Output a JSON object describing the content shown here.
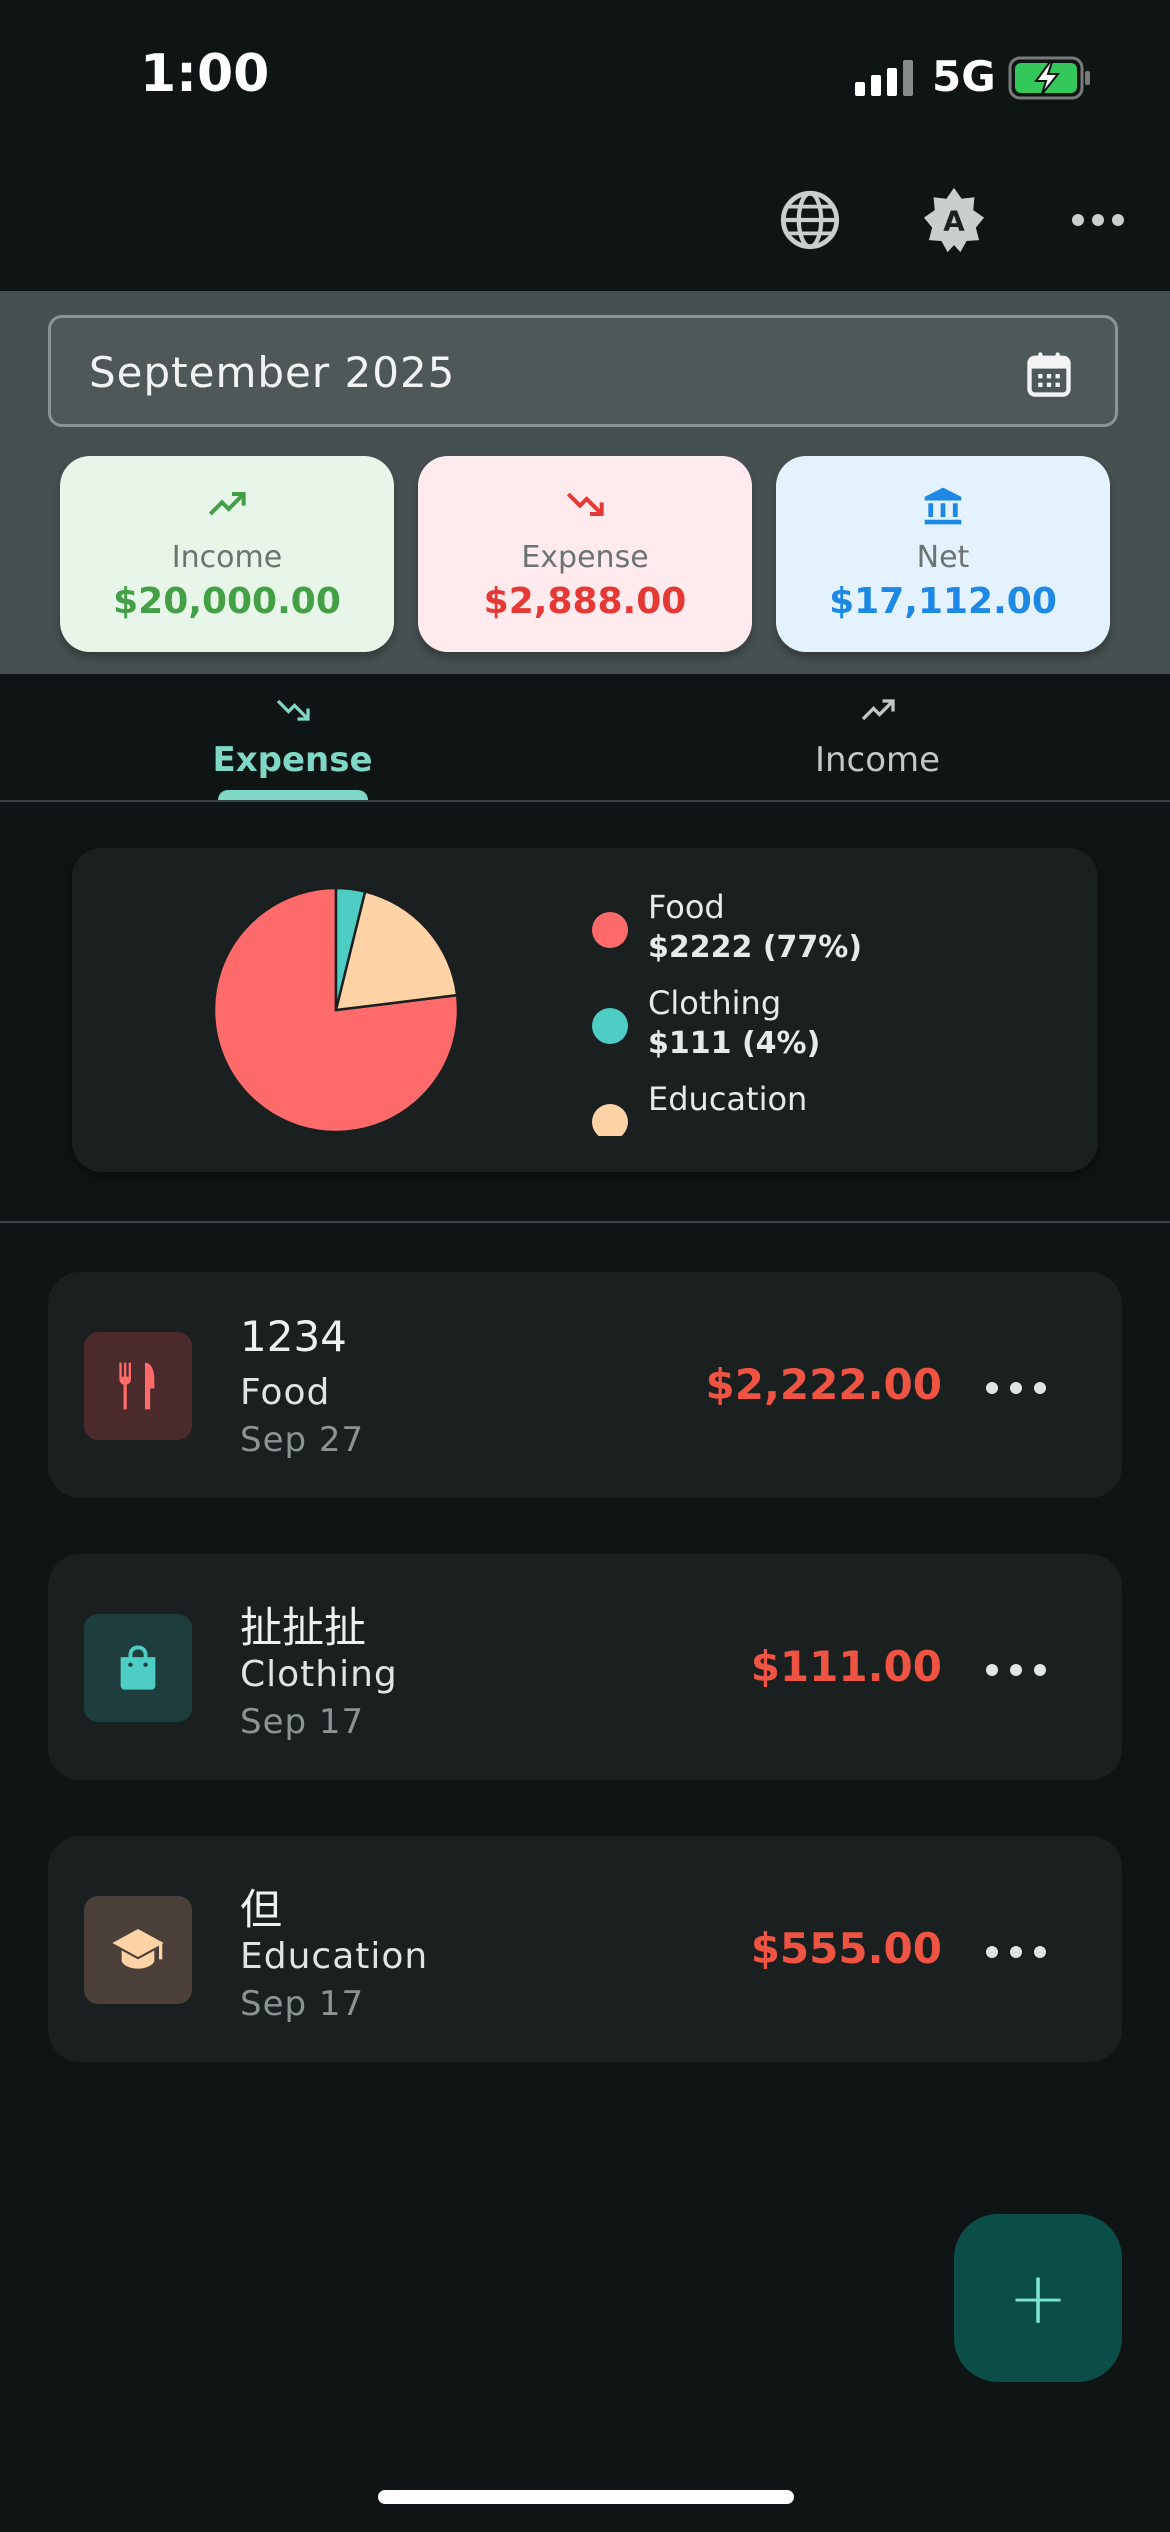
{
  "status_bar": {
    "time": "1:00",
    "network": "5G"
  },
  "app_bar": {
    "actions": [
      "globe-icon",
      "brightness-auto-icon",
      "more-horiz-icon"
    ]
  },
  "month_picker": {
    "value": "September 2025",
    "icon": "calendar-icon"
  },
  "summary": {
    "income": {
      "label": "Income",
      "value": "$20,000.00",
      "color": "#43a047",
      "bg": "#e8f5e9"
    },
    "expense": {
      "label": "Expense",
      "value": "$2,888.00",
      "color": "#e53935",
      "bg": "#ffebee"
    },
    "net": {
      "label": "Net",
      "value": "$17,112.00",
      "color": "#1e88e5",
      "bg": "#e3f2fd"
    }
  },
  "tabs": [
    {
      "label": "Expense",
      "icon": "trending-down-icon",
      "active": true
    },
    {
      "label": "Income",
      "icon": "trending-up-icon",
      "active": false
    }
  ],
  "chart_data": {
    "type": "pie",
    "slices": [
      {
        "label": "Food",
        "value": 2222,
        "display": "$2222 (77%)",
        "color": "#ff6b6b"
      },
      {
        "label": "Clothing",
        "value": 111,
        "display": "$111 (4%)",
        "color": "#4ecdc4"
      },
      {
        "label": "Education",
        "value": 555,
        "display": "",
        "color": "#ffd3a5"
      }
    ]
  },
  "transactions": [
    {
      "title": "1234",
      "category": "Food",
      "date": "Sep 27",
      "amount": "$2,222.00",
      "icon": "restaurant-icon",
      "icon_color": "#ff6b6b",
      "icon_bg": "#4a2a2b"
    },
    {
      "title": "扯扯扯",
      "category": "Clothing",
      "date": "Sep 17",
      "amount": "$111.00",
      "icon": "shopping-bag-icon",
      "icon_color": "#4ecdc4",
      "icon_bg": "#1e3e3d"
    },
    {
      "title": "但",
      "category": "Education",
      "date": "Sep 17",
      "amount": "$555.00",
      "icon": "school-icon",
      "icon_color": "#ffd3a5",
      "icon_bg": "#4a4039"
    }
  ],
  "fab": {
    "label": "+"
  }
}
